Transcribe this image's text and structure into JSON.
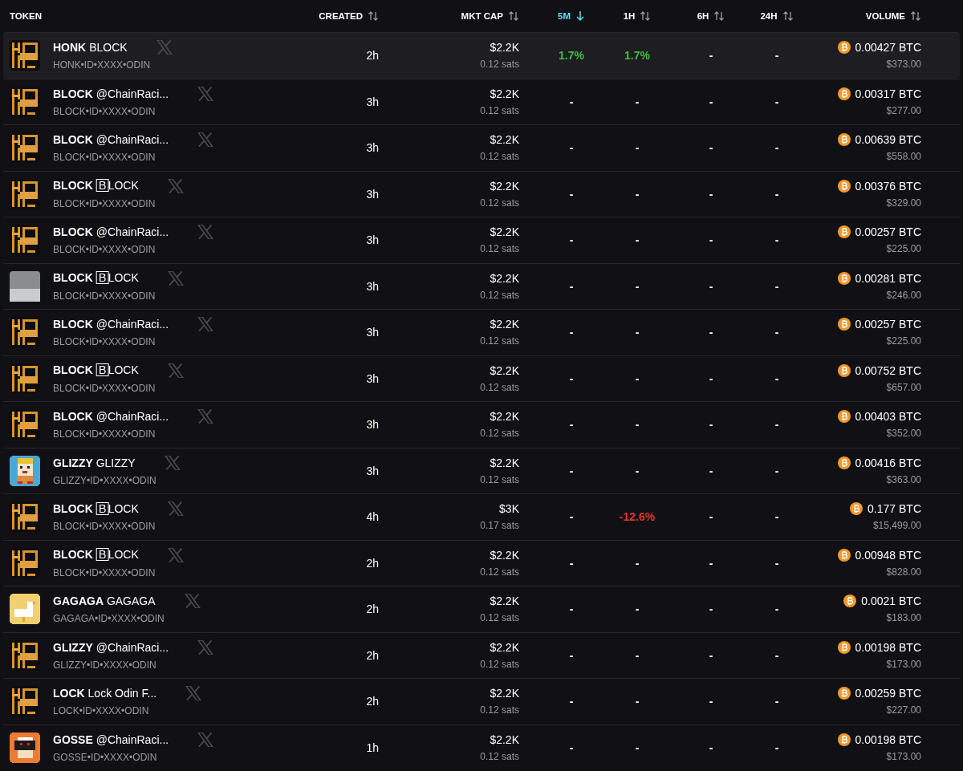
{
  "columns": [
    {
      "label": "TOKEN",
      "sortable": false,
      "selected": false
    },
    {
      "label": "CREATED",
      "sortable": true,
      "selected": false
    },
    {
      "label": "MKT CAP",
      "sortable": true,
      "selected": false
    },
    {
      "label": "5M",
      "sortable": true,
      "selected": true
    },
    {
      "label": "1H",
      "sortable": true,
      "selected": false
    },
    {
      "label": "6H",
      "sortable": true,
      "selected": false
    },
    {
      "label": "24H",
      "sortable": true,
      "selected": false
    },
    {
      "label": "VOLUME",
      "sortable": true,
      "selected": false
    }
  ],
  "rows": [
    {
      "kind": "block",
      "ticker": "HONK",
      "name": "BLOCK",
      "id": "HONK•ID•XXXX•ODIN",
      "created": "2h",
      "mcap": "$2.2K",
      "price": "0.12 sats",
      "changes": [
        {
          "text": "1.7%",
          "color": "#3fbf3f"
        },
        {
          "text": "1.7%",
          "color": "#3fbf3f"
        },
        {
          "text": "-"
        },
        {
          "text": "-"
        }
      ],
      "volume_btc": "0.00427 BTC",
      "volume_usd": "$373.00",
      "selected": true
    },
    {
      "kind": "block",
      "ticker": "BLOCK",
      "name": "@ChainRaci...",
      "id": "BLOCK•ID•XXXX•ODIN",
      "created": "3h",
      "mcap": "$2.2K",
      "price": "0.12 sats",
      "changes": [
        {
          "text": "-"
        },
        {
          "text": "-"
        },
        {
          "text": "-"
        },
        {
          "text": "-"
        }
      ],
      "volume_btc": "0.00317 BTC",
      "volume_usd": "$277.00",
      "selected": false
    },
    {
      "kind": "block",
      "ticker": "BLOCK",
      "name": "@ChainRaci...",
      "id": "BLOCK•ID•XXXX•ODIN",
      "created": "3h",
      "mcap": "$2.2K",
      "price": "0.12 sats",
      "changes": [
        {
          "text": "-"
        },
        {
          "text": "-"
        },
        {
          "text": "-"
        },
        {
          "text": "-"
        }
      ],
      "volume_btc": "0.00639 BTC",
      "volume_usd": "$558.00",
      "selected": false
    },
    {
      "kind": "block",
      "ticker": "BLOCK",
      "name": "🄱LOCK",
      "id": "BLOCK•ID•XXXX•ODIN",
      "created": "3h",
      "mcap": "$2.2K",
      "price": "0.12 sats",
      "changes": [
        {
          "text": "-"
        },
        {
          "text": "-"
        },
        {
          "text": "-"
        },
        {
          "text": "-"
        }
      ],
      "volume_btc": "0.00376 BTC",
      "volume_usd": "$329.00",
      "selected": false
    },
    {
      "kind": "block",
      "ticker": "BLOCK",
      "name": "@ChainRaci...",
      "id": "BLOCK•ID•XXXX•ODIN",
      "created": "3h",
      "mcap": "$2.2K",
      "price": "0.12 sats",
      "changes": [
        {
          "text": "-"
        },
        {
          "text": "-"
        },
        {
          "text": "-"
        },
        {
          "text": "-"
        }
      ],
      "volume_btc": "0.00257 BTC",
      "volume_usd": "$225.00",
      "selected": false
    },
    {
      "kind": "photo",
      "ticker": "BLOCK",
      "name": "🄱LOCK",
      "id": "BLOCK•ID•XXXX•ODIN",
      "created": "3h",
      "mcap": "$2.2K",
      "price": "0.12 sats",
      "changes": [
        {
          "text": "-"
        },
        {
          "text": "-"
        },
        {
          "text": "-"
        },
        {
          "text": "-"
        }
      ],
      "volume_btc": "0.00281 BTC",
      "volume_usd": "$246.00",
      "selected": false
    },
    {
      "kind": "block",
      "ticker": "BLOCK",
      "name": "@ChainRaci...",
      "id": "BLOCK•ID•XXXX•ODIN",
      "created": "3h",
      "mcap": "$2.2K",
      "price": "0.12 sats",
      "changes": [
        {
          "text": "-"
        },
        {
          "text": "-"
        },
        {
          "text": "-"
        },
        {
          "text": "-"
        }
      ],
      "volume_btc": "0.00257 BTC",
      "volume_usd": "$225.00",
      "selected": false
    },
    {
      "kind": "block",
      "ticker": "BLOCK",
      "name": "🄱LOCK",
      "id": "BLOCK•ID•XXXX•ODIN",
      "created": "3h",
      "mcap": "$2.2K",
      "price": "0.12 sats",
      "changes": [
        {
          "text": "-"
        },
        {
          "text": "-"
        },
        {
          "text": "-"
        },
        {
          "text": "-"
        }
      ],
      "volume_btc": "0.00752 BTC",
      "volume_usd": "$657.00",
      "selected": false
    },
    {
      "kind": "block",
      "ticker": "BLOCK",
      "name": "@ChainRaci...",
      "id": "BLOCK•ID•XXXX•ODIN",
      "created": "3h",
      "mcap": "$2.2K",
      "price": "0.12 sats",
      "changes": [
        {
          "text": "-"
        },
        {
          "text": "-"
        },
        {
          "text": "-"
        },
        {
          "text": "-"
        }
      ],
      "volume_btc": "0.00403 BTC",
      "volume_usd": "$352.00",
      "selected": false
    },
    {
      "kind": "glizzy",
      "ticker": "GLIZZY",
      "name": "GLIZZY",
      "id": "GLIZZY•ID•XXXX•ODIN",
      "created": "3h",
      "mcap": "$2.2K",
      "price": "0.12 sats",
      "changes": [
        {
          "text": "-"
        },
        {
          "text": "-"
        },
        {
          "text": "-"
        },
        {
          "text": "-"
        }
      ],
      "volume_btc": "0.00416 BTC",
      "volume_usd": "$363.00",
      "selected": false
    },
    {
      "kind": "block",
      "ticker": "BLOCK",
      "name": "🄱LOCK",
      "id": "BLOCK•ID•XXXX•ODIN",
      "created": "4h",
      "mcap": "$3K",
      "price": "0.17 sats",
      "changes": [
        {
          "text": "-"
        },
        {
          "text": "-12.6%",
          "color": "#e0392b"
        },
        {
          "text": "-"
        },
        {
          "text": "-"
        }
      ],
      "volume_btc": "0.177 BTC",
      "volume_usd": "$15,499.00",
      "selected": false
    },
    {
      "kind": "block",
      "ticker": "BLOCK",
      "name": "🄱LOCK",
      "id": "BLOCK•ID•XXXX•ODIN",
      "created": "2h",
      "mcap": "$2.2K",
      "price": "0.12 sats",
      "changes": [
        {
          "text": "-"
        },
        {
          "text": "-"
        },
        {
          "text": "-"
        },
        {
          "text": "-"
        }
      ],
      "volume_btc": "0.00948 BTC",
      "volume_usd": "$828.00",
      "selected": false
    },
    {
      "kind": "goose",
      "ticker": "GAGAGA",
      "name": "GAGAGA",
      "id": "GAGAGA•ID•XXXX•ODIN",
      "created": "2h",
      "mcap": "$2.2K",
      "price": "0.12 sats",
      "changes": [
        {
          "text": "-"
        },
        {
          "text": "-"
        },
        {
          "text": "-"
        },
        {
          "text": "-"
        }
      ],
      "volume_btc": "0.0021 BTC",
      "volume_usd": "$183.00",
      "selected": false
    },
    {
      "kind": "block",
      "ticker": "GLIZZY",
      "name": "@ChainRaci...",
      "id": "GLIZZY•ID•XXXX•ODIN",
      "created": "2h",
      "mcap": "$2.2K",
      "price": "0.12 sats",
      "changes": [
        {
          "text": "-"
        },
        {
          "text": "-"
        },
        {
          "text": "-"
        },
        {
          "text": "-"
        }
      ],
      "volume_btc": "0.00198 BTC",
      "volume_usd": "$173.00",
      "selected": false
    },
    {
      "kind": "block",
      "ticker": "LOCK",
      "name": "Lock Odin F...",
      "id": "LOCK•ID•XXXX•ODIN",
      "created": "2h",
      "mcap": "$2.2K",
      "price": "0.12 sats",
      "changes": [
        {
          "text": "-"
        },
        {
          "text": "-"
        },
        {
          "text": "-"
        },
        {
          "text": "-"
        }
      ],
      "volume_btc": "0.00259 BTC",
      "volume_usd": "$227.00",
      "selected": false
    },
    {
      "kind": "robot",
      "ticker": "GOSSE",
      "name": "@ChainRaci...",
      "id": "GOSSE•ID•XXXX•ODIN",
      "created": "1h",
      "mcap": "$2.2K",
      "price": "0.12 sats",
      "changes": [
        {
          "text": "-"
        },
        {
          "text": "-"
        },
        {
          "text": "-"
        },
        {
          "text": "-"
        }
      ],
      "volume_btc": "0.00198 BTC",
      "volume_usd": "$173.00",
      "selected": false
    }
  ]
}
